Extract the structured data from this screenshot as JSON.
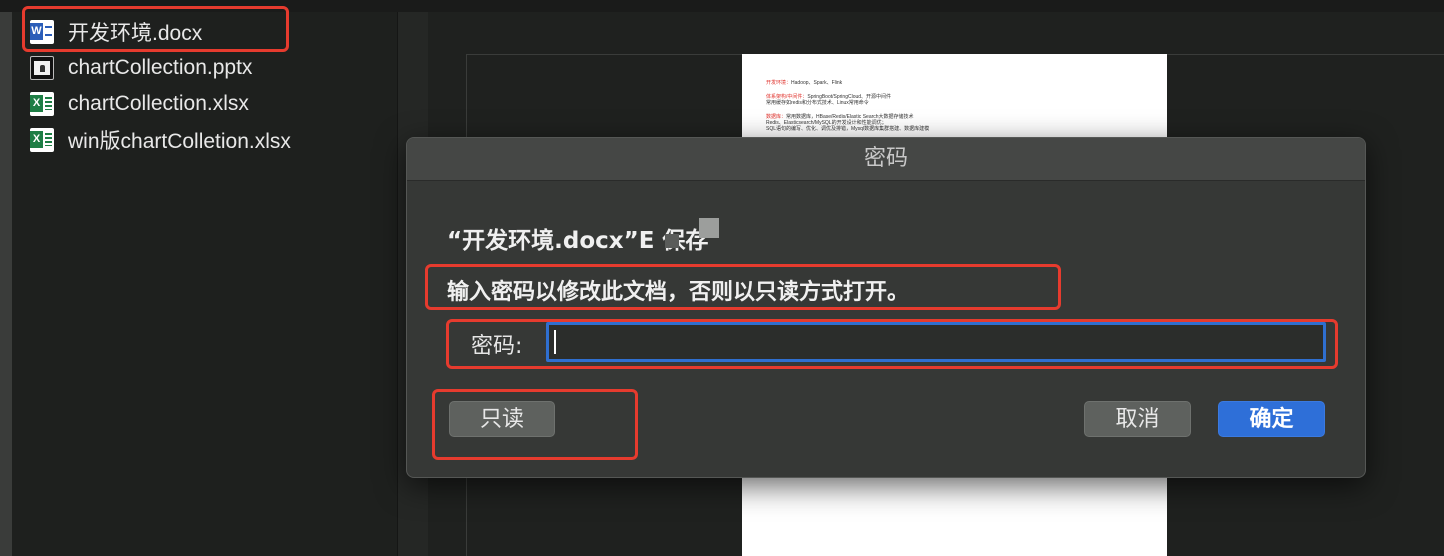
{
  "files": [
    {
      "name": "开发环境.docx",
      "icon": "word-document-icon"
    },
    {
      "name": "chartCollection.pptx",
      "icon": "powerpoint-document-icon"
    },
    {
      "name": "chartCollection.xlsx",
      "icon": "excel-document-icon"
    },
    {
      "name": "win版chartColletion.xlsx",
      "icon": "excel-document-icon"
    }
  ],
  "preview": {
    "lines": [
      {
        "label": "开发环境：",
        "text": "Hadoop、Spark、Flink"
      },
      {
        "label": "体系架构/中间件：",
        "text": "SpringBoot/SpringCloud、开源中间件"
      },
      {
        "label": "",
        "text": "常用缓存如redis和分布式技术、Linux常用命令"
      },
      {
        "label": "数据库：",
        "text": "常用数据库，HBase/Redis/Elastic Search大数据存储技术"
      },
      {
        "label": "",
        "text": "Redis、Elasticsearch/MySQL的开发设计和性能调优；"
      },
      {
        "label": "",
        "text": "SQL语句的编写、优化、调优及排错，Mysql数据库集群搭建、数据库建模"
      }
    ]
  },
  "dialog": {
    "title": "密码",
    "heading": "“开发环境.docx”E        保存",
    "message": "输入密码以修改此文档，否则以只读方式打开。",
    "password_label": "密码:",
    "password_value": "",
    "buttons": {
      "read_only": "只读",
      "cancel": "取消",
      "ok": "确定"
    }
  },
  "colors": {
    "highlight": "#e63b2e",
    "accent_blue": "#2e6fd8",
    "dialog_bg": "#363836"
  }
}
